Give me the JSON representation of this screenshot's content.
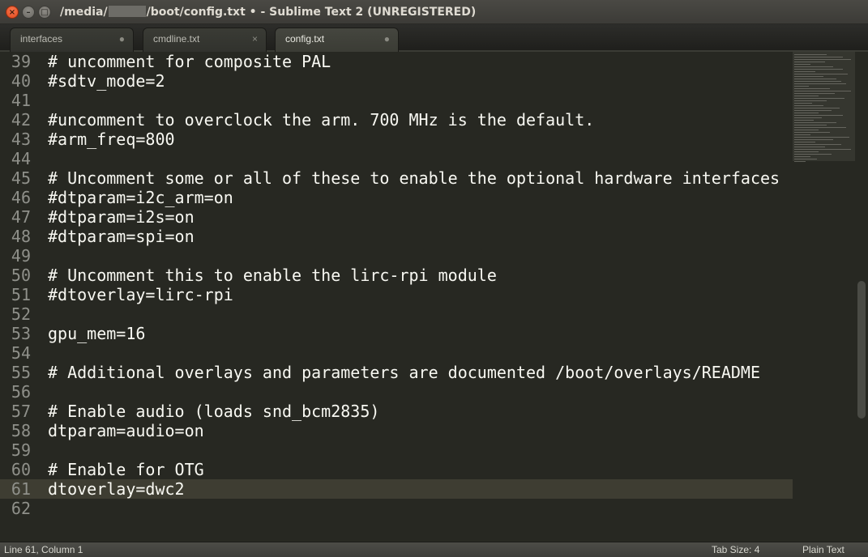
{
  "window": {
    "title_prefix": "/media/",
    "title_suffix": "/boot/config.txt • - Sublime Text 2 (UNREGISTERED)"
  },
  "tabs": [
    {
      "label": "interfaces",
      "close": "●"
    },
    {
      "label": "cmdline.txt",
      "close": "×"
    },
    {
      "label": "config.txt",
      "close": "●"
    }
  ],
  "editor": {
    "lines": [
      {
        "num": "39",
        "text": "# uncomment for composite PAL"
      },
      {
        "num": "40",
        "text": "#sdtv_mode=2"
      },
      {
        "num": "41",
        "text": ""
      },
      {
        "num": "42",
        "text": "#uncomment to overclock the arm. 700 MHz is the default."
      },
      {
        "num": "43",
        "text": "#arm_freq=800"
      },
      {
        "num": "44",
        "text": ""
      },
      {
        "num": "45",
        "text": "# Uncomment some or all of these to enable the optional hardware interfaces"
      },
      {
        "num": "46",
        "text": "#dtparam=i2c_arm=on"
      },
      {
        "num": "47",
        "text": "#dtparam=i2s=on"
      },
      {
        "num": "48",
        "text": "#dtparam=spi=on"
      },
      {
        "num": "49",
        "text": ""
      },
      {
        "num": "50",
        "text": "# Uncomment this to enable the lirc-rpi module"
      },
      {
        "num": "51",
        "text": "#dtoverlay=lirc-rpi"
      },
      {
        "num": "52",
        "text": ""
      },
      {
        "num": "53",
        "text": "gpu_mem=16"
      },
      {
        "num": "54",
        "text": ""
      },
      {
        "num": "55",
        "text": "# Additional overlays and parameters are documented /boot/overlays/README"
      },
      {
        "num": "56",
        "text": ""
      },
      {
        "num": "57",
        "text": "# Enable audio (loads snd_bcm2835)"
      },
      {
        "num": "58",
        "text": "dtparam=audio=on"
      },
      {
        "num": "59",
        "text": ""
      },
      {
        "num": "60",
        "text": "# Enable for OTG"
      },
      {
        "num": "61",
        "text": "dtoverlay=dwc2"
      },
      {
        "num": "62",
        "text": ""
      }
    ],
    "current_line": "61"
  },
  "statusbar": {
    "position": "Line 61, Column 1",
    "tab_size": "Tab Size: 4",
    "syntax": "Plain Text"
  },
  "colors": {
    "background": "#272822",
    "current_line": "#3e3d32",
    "text": "#f8f8f2",
    "gutter_text": "#8f908a"
  }
}
